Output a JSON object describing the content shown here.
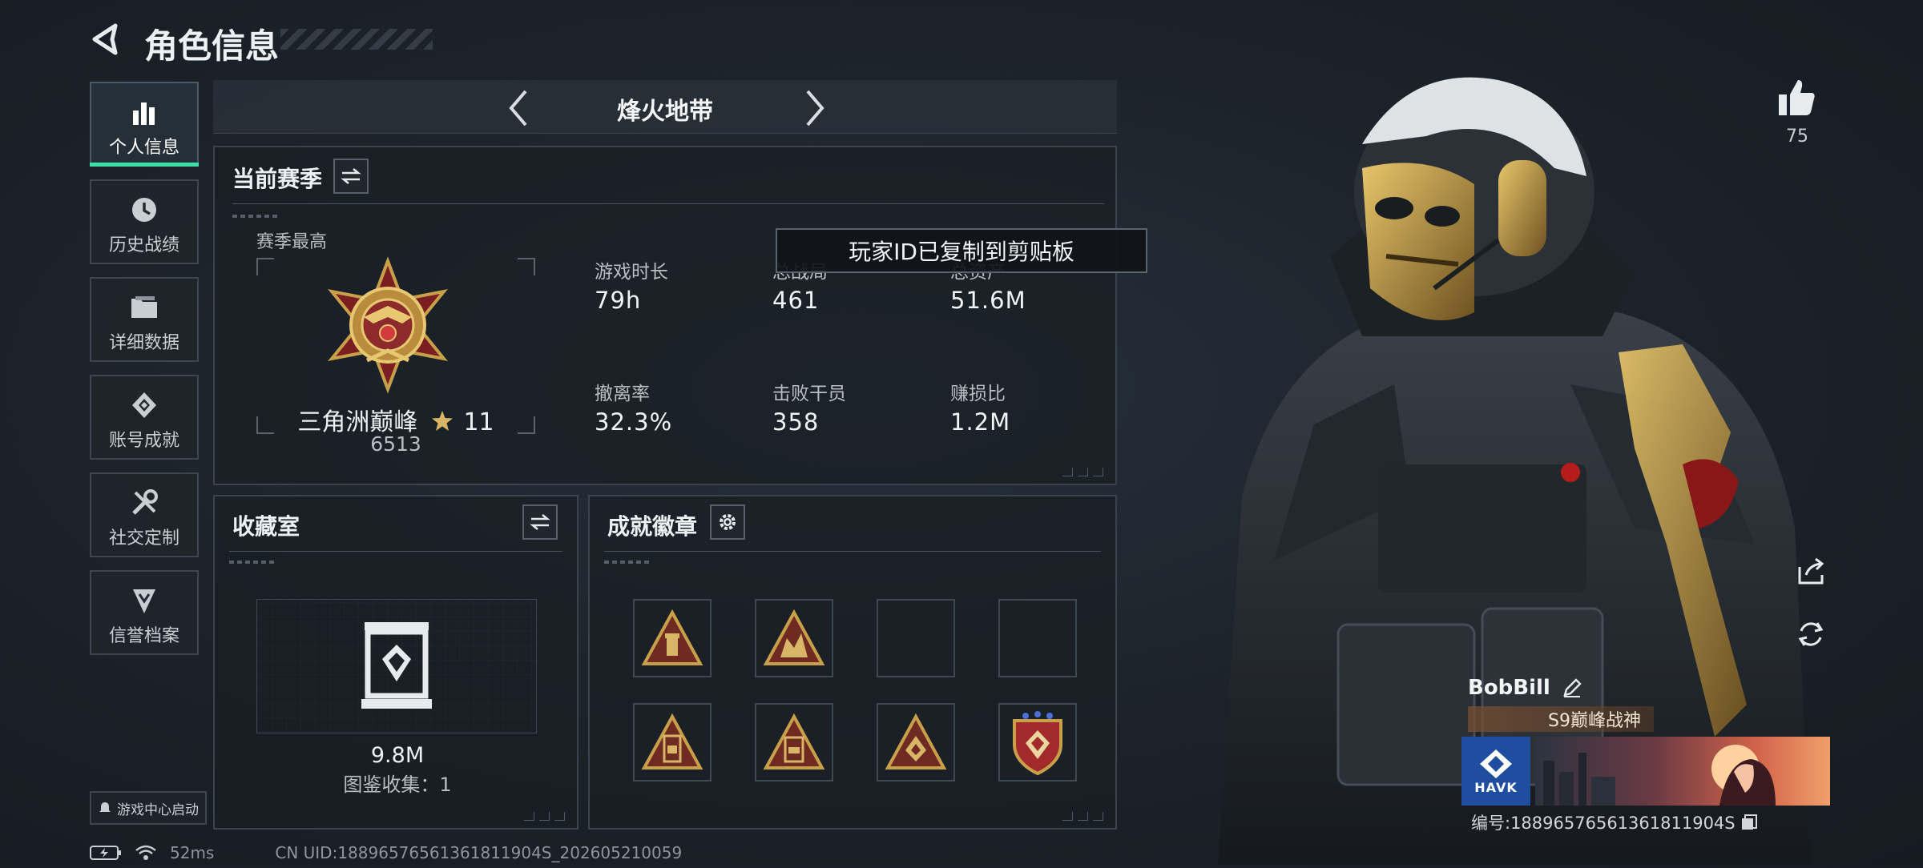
{
  "header": {
    "title": "角色信息"
  },
  "sidebar": {
    "items": [
      {
        "label": "个人信息",
        "icon": "bar-chart-icon",
        "active": true
      },
      {
        "label": "历史战绩",
        "icon": "history-icon"
      },
      {
        "label": "详细数据",
        "icon": "folder-icon"
      },
      {
        "label": "账号成就",
        "icon": "achievement-icon"
      },
      {
        "label": "社交定制",
        "icon": "tools-icon"
      },
      {
        "label": "信誉档案",
        "icon": "reputation-icon"
      }
    ],
    "game_center": "游戏中心启动"
  },
  "mode_selector": {
    "label": "烽火地带"
  },
  "season": {
    "title": "当前赛季",
    "best_label": "赛季最高",
    "rank_name": "三角洲巅峰",
    "rank_stars": "11",
    "rank_points": "6513",
    "stats": [
      {
        "label": "游戏时长",
        "value": "79h"
      },
      {
        "label": "总战局",
        "value": "461"
      },
      {
        "label": "总资产",
        "value": "51.6M"
      },
      {
        "label": "撤离率",
        "value": "32.3%"
      },
      {
        "label": "击败干员",
        "value": "358"
      },
      {
        "label": "赚损比",
        "value": "1.2M"
      }
    ]
  },
  "toast": {
    "text": "玩家ID已复制到剪贴板"
  },
  "collection": {
    "title": "收藏室",
    "value": "9.8M",
    "count_text": "图鉴收集：1"
  },
  "badges": {
    "title": "成就徽章"
  },
  "likes": {
    "count": "75"
  },
  "player": {
    "name": "BobBill",
    "title": "S9巅峰战神",
    "team": "HAVK",
    "id_text": "编号:18896576561361811904S"
  },
  "status_bar": {
    "ping": "52ms",
    "uid": "CN UID:18896576561361811904S_202605210059"
  },
  "colors": {
    "accent": "#3de0a8",
    "gold": "#c8a04a"
  }
}
